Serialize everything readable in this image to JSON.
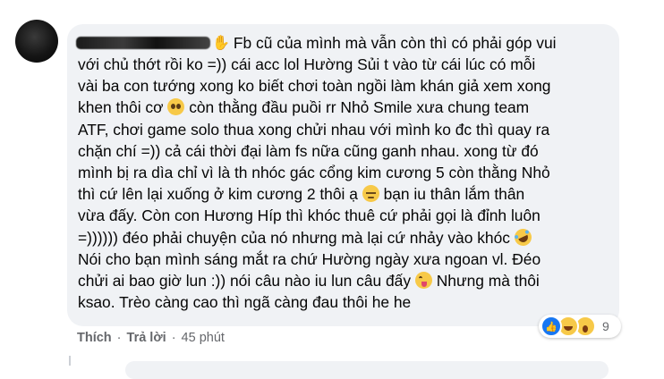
{
  "comment": {
    "lines": [
      [
        {
          "t": "với chủ thớt rồi ko =)) cái acc lol Hường Sủi t vào từ cái lúc có mỗi"
        }
      ],
      [
        {
          "t": "vài ba con tướng xong ko biết chơi toàn ngồi làm khán giả xem xong"
        }
      ],
      [
        {
          "t": "khen thôi cơ "
        },
        {
          "e": "pleading-face-emoji"
        },
        {
          "t": " còn thằng đầu puồi rr Nhỏ Smile xưa chung team"
        }
      ],
      [
        {
          "t": "ATF, chơi game solo thua xong chửi nhau với mình ko đc thì quay ra"
        }
      ],
      [
        {
          "t": "chặn chí =)) cả cái thời đại làm fs nữa cũng ganh nhau. xong từ đó"
        }
      ],
      [
        {
          "t": "mình bị ra dìa chỉ vì là th nhóc gác cổng kim cương 5 còn thằng Nhỏ"
        }
      ],
      [
        {
          "t": "thì cứ lên lại xuống ở kim cương 2 thôi ạ "
        },
        {
          "e": "pensive-face-emoji"
        },
        {
          "t": " bạn iu thân lắm thân"
        }
      ],
      [
        {
          "t": "vừa đấy. Còn con Hương Híp thì khóc thuê cứ phải gọi là đỉnh luôn"
        }
      ],
      [
        {
          "t": "=)))))) đéo phải chuyện của nó nhưng mà lại cứ nhảy vào khóc "
        },
        {
          "e": "rofl-emoji"
        }
      ],
      [
        {
          "t": "Nói cho bạn mình sáng mắt ra chứ Hường ngày xưa ngoan vl. Đéo"
        }
      ],
      [
        {
          "t": "chửi ai bao giờ lun :)) nói câu nào iu lun câu đấy "
        },
        {
          "e": "tongue-emoji"
        },
        {
          "t": " Nhưng mà thôi"
        }
      ],
      [
        {
          "t": "ksao. Trèo càng cao thì ngã càng đau thôi he he"
        }
      ]
    ],
    "first_line": "Fb cũ của mình mà vẫn còn thì có phải góp vui",
    "reactions": {
      "count": "9",
      "icons": [
        "like-icon",
        "haha-icon",
        "wow-icon"
      ]
    },
    "actions": {
      "like": "Thích",
      "reply": "Trả lời",
      "separator": "·",
      "time": "45 phút"
    }
  },
  "colors": {
    "bubble": "#f0f2f5",
    "text": "#050505",
    "meta": "#65676b",
    "like_blue": "#1877f2"
  }
}
